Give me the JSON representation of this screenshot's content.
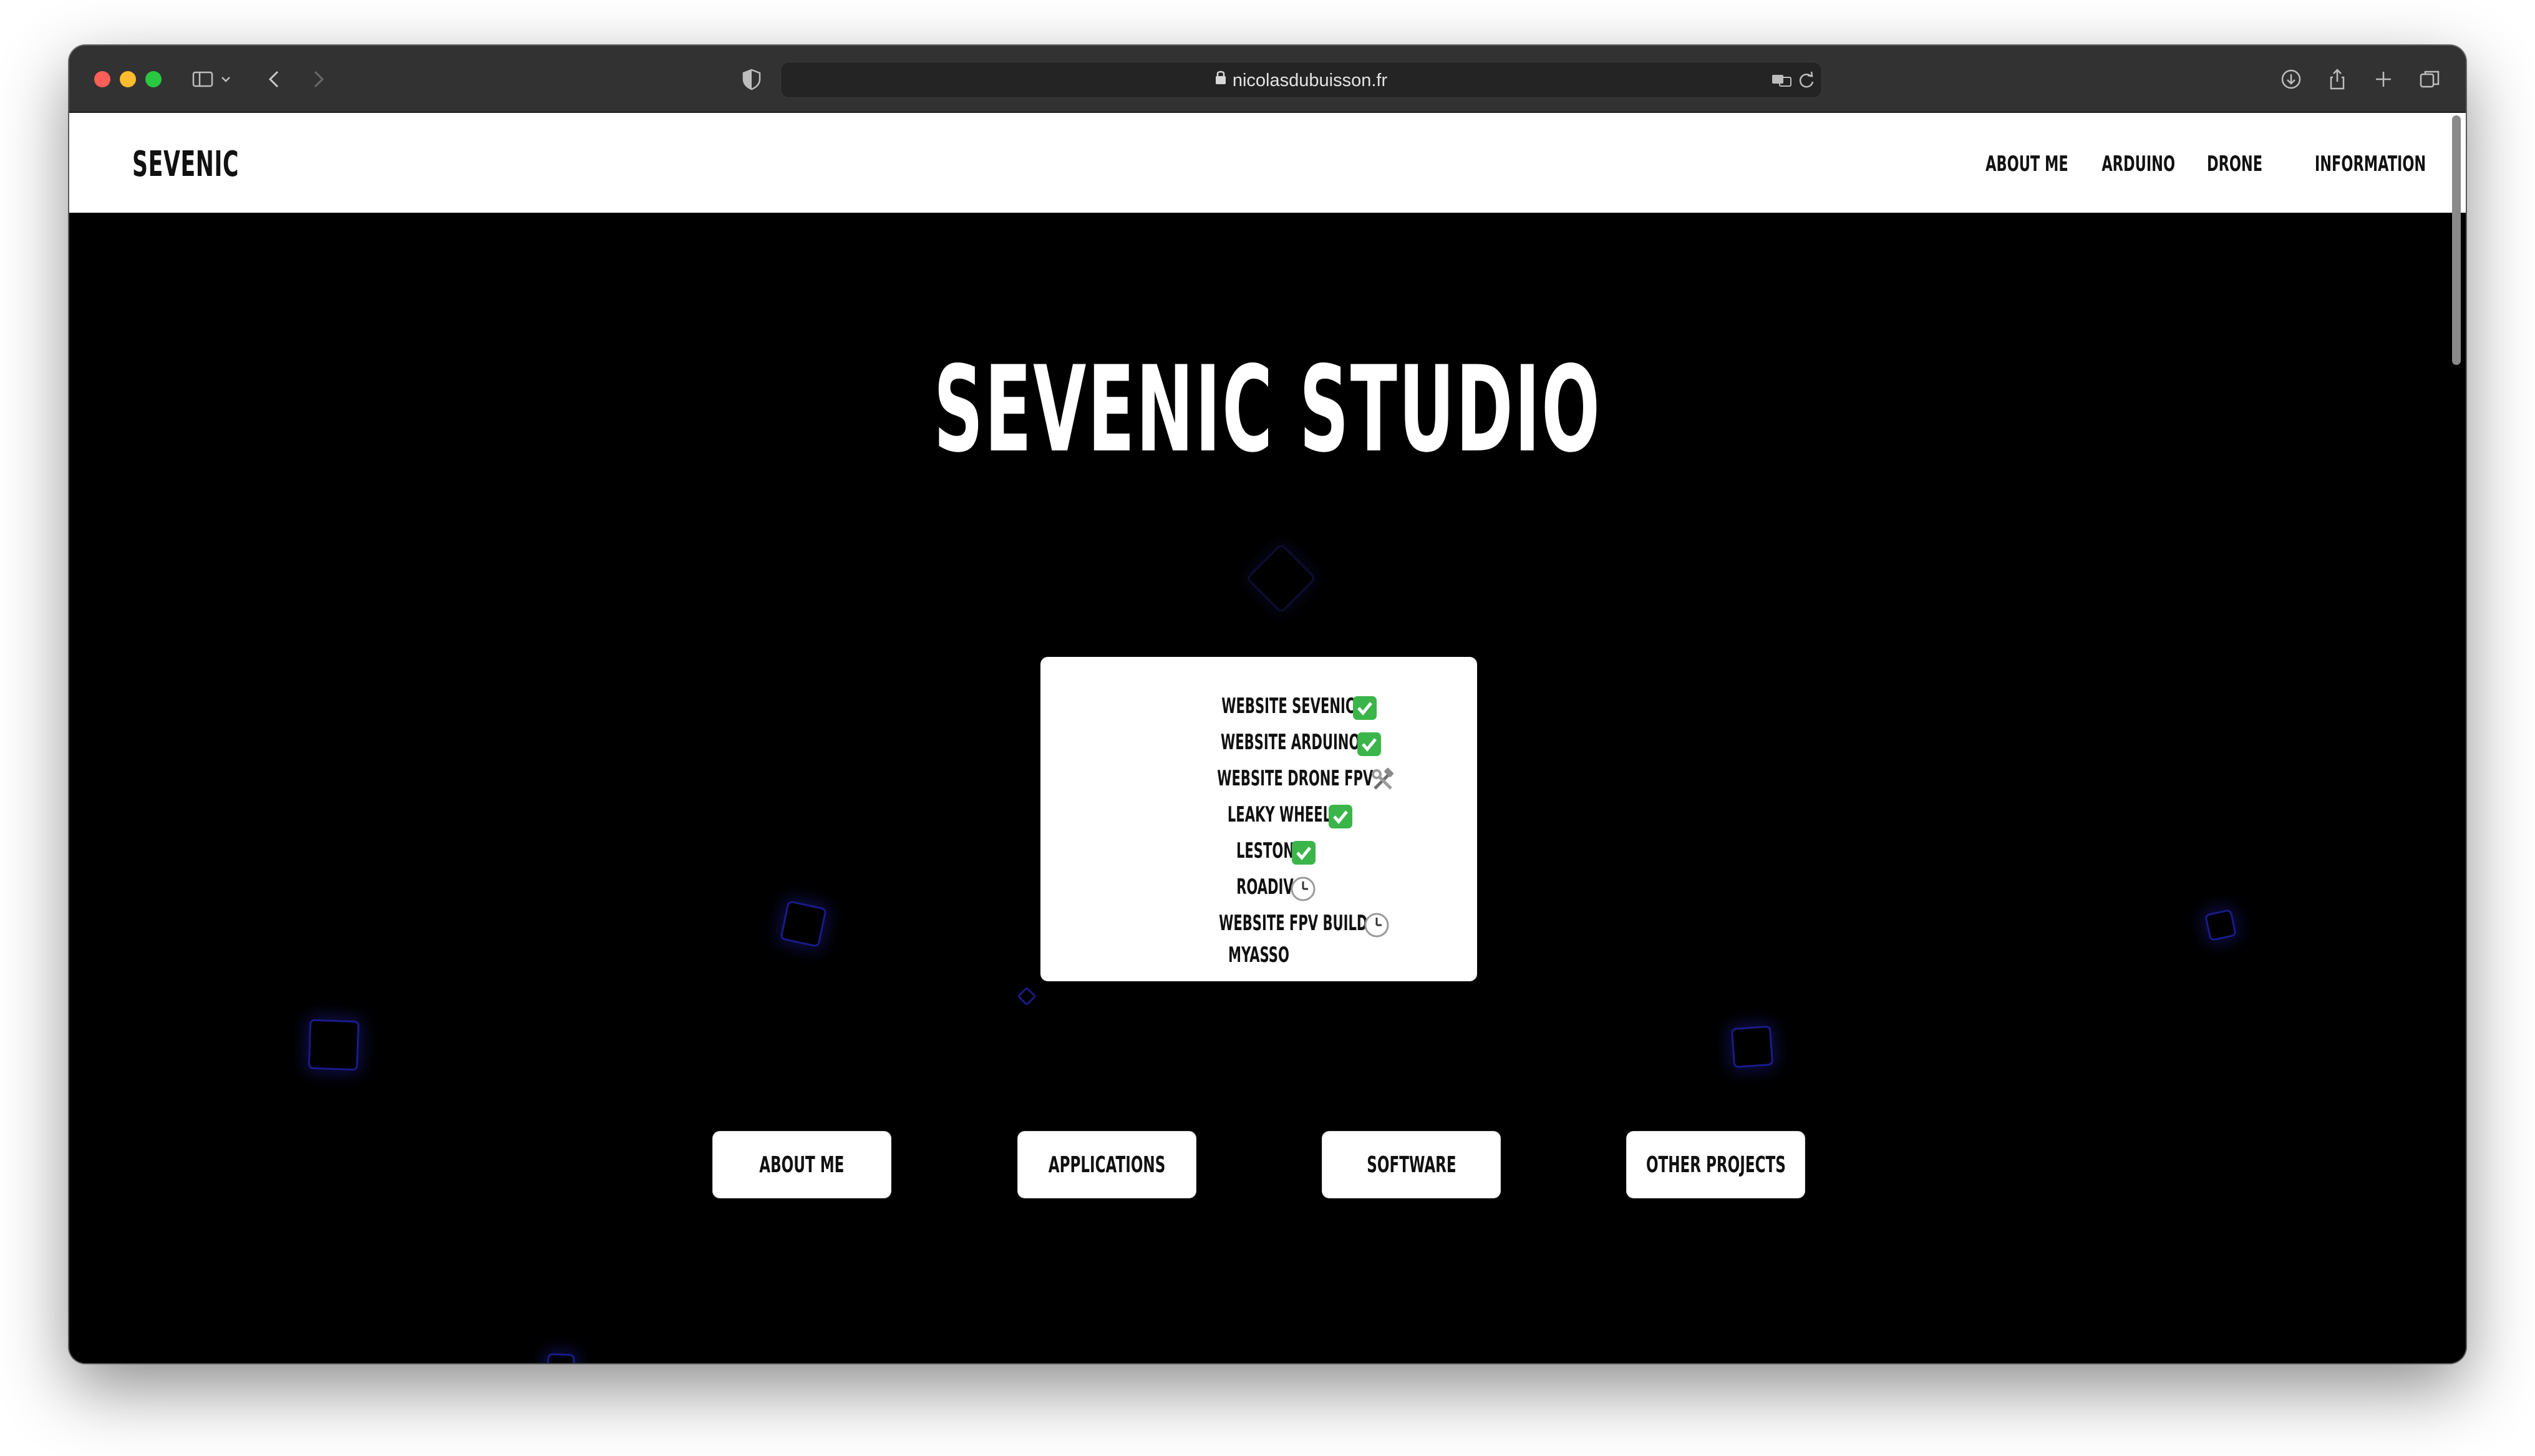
{
  "browser": {
    "url": "nicolasdubuisson.fr",
    "icons": [
      "sidebar-icon",
      "chevron-down-icon",
      "back-icon",
      "forward-icon",
      "privacy-shield-icon",
      "lock-icon",
      "translate-icon",
      "reload-icon",
      "download-icon",
      "share-icon",
      "new-tab-icon",
      "tab-overview-icon"
    ]
  },
  "site": {
    "brand": "SEVENIC",
    "nav": [
      "ABOUT ME",
      "ARDUINO",
      "DRONE",
      "INFORMATION"
    ]
  },
  "hero": {
    "title": "SEVENIC STUDIO",
    "projects": [
      {
        "label": "WEBSITE SEVENIC",
        "status": "check-mark-icon"
      },
      {
        "label": "WEBSITE ARDUINO",
        "status": "check-mark-icon"
      },
      {
        "label": "WEBSITE DRONE FPV",
        "status": "hammer-wrench-icon"
      },
      {
        "label": "LEAKY WHEEL",
        "status": "check-mark-icon"
      },
      {
        "label": "LESTON",
        "status": "check-mark-icon"
      },
      {
        "label": "ROADIV",
        "status": "clock-icon"
      },
      {
        "label": "WEBSITE FPV BUILD",
        "status": "clock-icon"
      },
      {
        "label": "MYASSO",
        "status": ""
      }
    ],
    "buttons": [
      "ABOUT ME",
      "APPLICATIONS",
      "SOFTWARE",
      "OTHER PROJECTS"
    ]
  },
  "colors": {
    "background": "#000000",
    "header": "#ffffff",
    "accent_glow": "#1a1a8a",
    "check": "#3bb54a"
  }
}
